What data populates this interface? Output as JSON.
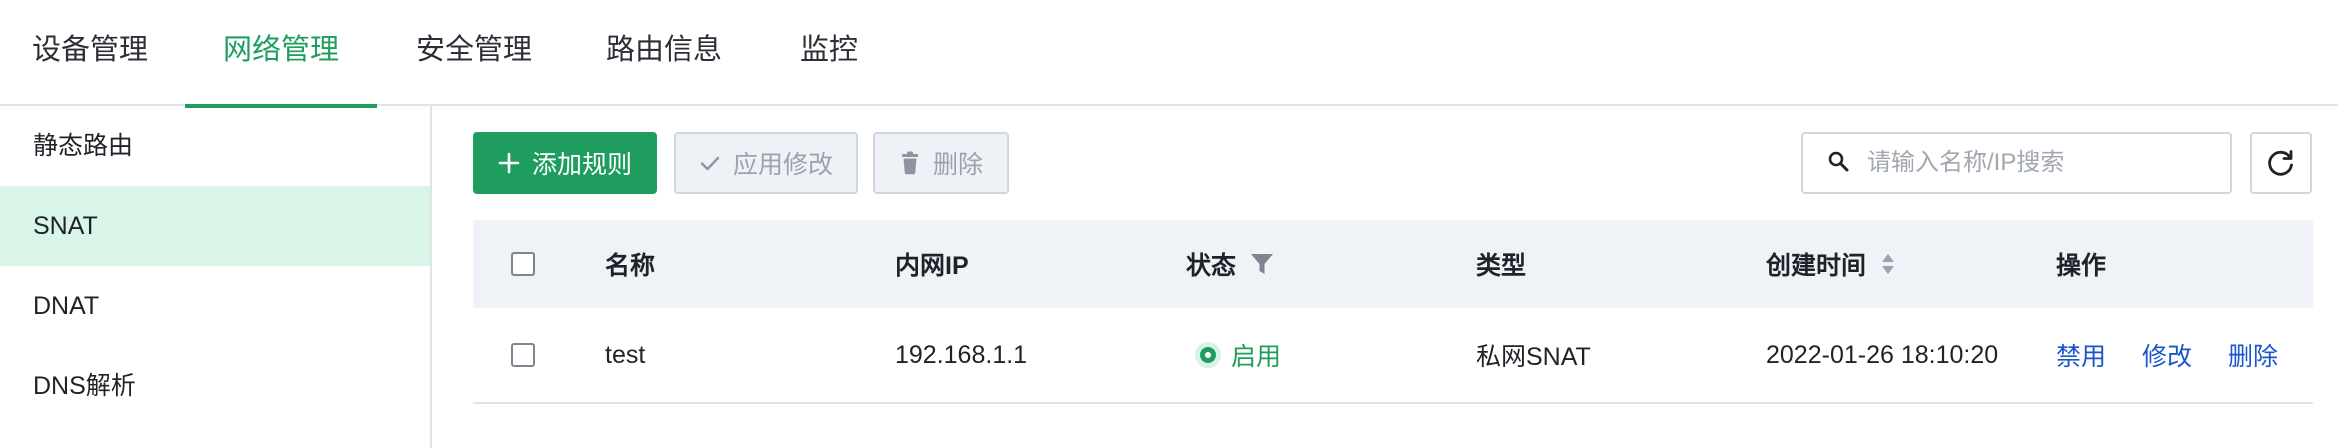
{
  "topnav": {
    "tabs": [
      {
        "label": "设备管理"
      },
      {
        "label": "网络管理"
      },
      {
        "label": "安全管理"
      },
      {
        "label": "路由信息"
      },
      {
        "label": "监控"
      }
    ]
  },
  "sidebar": {
    "items": [
      {
        "label": "静态路由"
      },
      {
        "label": "SNAT"
      },
      {
        "label": "DNAT"
      },
      {
        "label": "DNS解析"
      }
    ]
  },
  "toolbar": {
    "add_label": "添加规则",
    "apply_label": "应用修改",
    "delete_label": "删除"
  },
  "search": {
    "placeholder": "请输入名称/IP搜索",
    "value": ""
  },
  "table": {
    "columns": [
      "名称",
      "内网IP",
      "状态",
      "类型",
      "创建时间",
      "操作"
    ],
    "rows": [
      {
        "name": "test",
        "ip": "192.168.1.1",
        "status": "启用",
        "type": "私网SNAT",
        "created": "2022-01-26 18:10:20",
        "actions": [
          "禁用",
          "修改",
          "删除"
        ]
      }
    ]
  },
  "colors": {
    "accent": "#1f9d5f",
    "link": "#1a56c9",
    "sidebar_active_bg": "#d8f5e8",
    "header_bg": "#eff3f8"
  }
}
